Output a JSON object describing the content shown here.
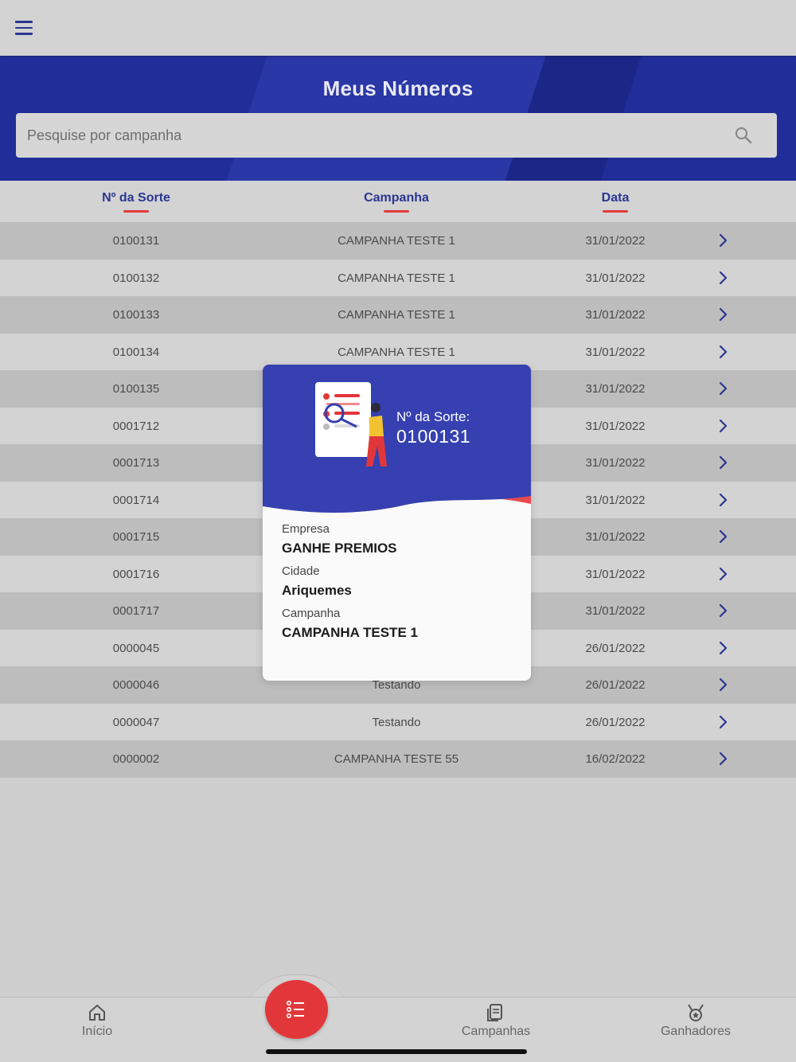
{
  "hero": {
    "title": "Meus Números"
  },
  "search": {
    "placeholder": "Pesquise por campanha"
  },
  "columns": {
    "sorte": "Nº da Sorte",
    "campanha": "Campanha",
    "data": "Data"
  },
  "rows": [
    {
      "num": "0100131",
      "campanha": "CAMPANHA TESTE 1",
      "data": "31/01/2022"
    },
    {
      "num": "0100132",
      "campanha": "CAMPANHA TESTE 1",
      "data": "31/01/2022"
    },
    {
      "num": "0100133",
      "campanha": "CAMPANHA TESTE 1",
      "data": "31/01/2022"
    },
    {
      "num": "0100134",
      "campanha": "CAMPANHA TESTE 1",
      "data": "31/01/2022"
    },
    {
      "num": "0100135",
      "campanha": "",
      "data": "31/01/2022"
    },
    {
      "num": "0001712",
      "campanha": "",
      "data": "31/01/2022"
    },
    {
      "num": "0001713",
      "campanha": "",
      "data": "31/01/2022"
    },
    {
      "num": "0001714",
      "campanha": "",
      "data": "31/01/2022"
    },
    {
      "num": "0001715",
      "campanha": "",
      "data": "31/01/2022"
    },
    {
      "num": "0001716",
      "campanha": "",
      "data": "31/01/2022"
    },
    {
      "num": "0001717",
      "campanha": "",
      "data": "31/01/2022"
    },
    {
      "num": "0000045",
      "campanha": "",
      "data": "26/01/2022"
    },
    {
      "num": "0000046",
      "campanha": "Testando",
      "data": "26/01/2022"
    },
    {
      "num": "0000047",
      "campanha": "Testando",
      "data": "26/01/2022"
    },
    {
      "num": "0000002",
      "campanha": "CAMPANHA TESTE 55",
      "data": "16/02/2022"
    }
  ],
  "modal": {
    "sorte_label": "Nº da Sorte:",
    "sorte_value": "0100131",
    "empresa_label": "Empresa",
    "empresa_value": "GANHE PREMIOS",
    "cidade_label": "Cidade",
    "cidade_value": "Ariquemes",
    "campanha_label": "Campanha",
    "campanha_value": "CAMPANHA TESTE 1"
  },
  "nav": {
    "inicio": "Início",
    "campanhas": "Campanhas",
    "ganhadores": "Ganhadores"
  },
  "icons": {
    "menu": "hamburger-icon",
    "search": "search-icon",
    "row": "chevron-right-icon",
    "fab": "list-icon",
    "home": "home-icon",
    "campanhas": "documents-icon",
    "ganhadores": "medal-icon"
  },
  "colors": {
    "primary": "#212e99",
    "accent": "#e2373a",
    "header_text": "#2b3592"
  }
}
